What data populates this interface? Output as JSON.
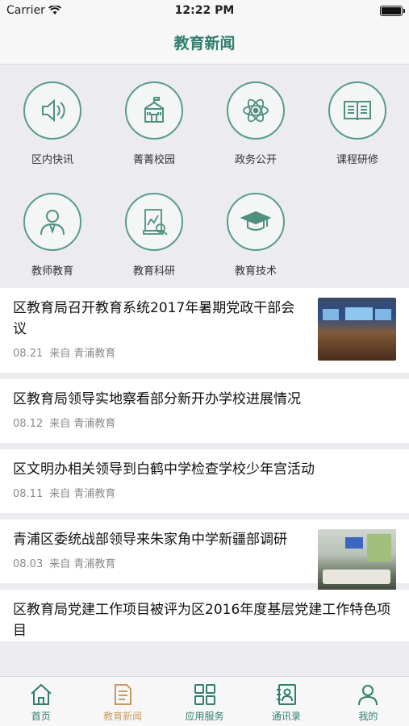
{
  "status_bar": {
    "carrier": "Carrier",
    "time": "12:22 PM"
  },
  "nav": {
    "title": "教育新闻"
  },
  "grid": {
    "items": [
      {
        "label": "区内快讯",
        "icon": "speaker-icon"
      },
      {
        "label": "菁菁校园",
        "icon": "school-icon"
      },
      {
        "label": "政务公开",
        "icon": "atom-icon"
      },
      {
        "label": "课程研修",
        "icon": "book-icon"
      },
      {
        "label": "教师教育",
        "icon": "teacher-icon"
      },
      {
        "label": "教育科研",
        "icon": "research-icon"
      },
      {
        "label": "教育技术",
        "icon": "graduation-cap-icon"
      }
    ]
  },
  "news": [
    {
      "headline": "区教育局召开教育系统2017年暑期党政干部会议",
      "date": "08.21",
      "source": "来自 青浦教育",
      "thumbnail": "meeting-hall-photo"
    },
    {
      "headline": "区教育局领导实地察看部分新开办学校进展情况",
      "date": "08.12",
      "source": "来自 青浦教育"
    },
    {
      "headline": "区文明办相关领导到白鹤中学检查学校少年宫活动",
      "date": "08.11",
      "source": "来自 青浦教育"
    },
    {
      "headline": "青浦区委统战部领导来朱家角中学新疆部调研",
      "date": "08.03",
      "source": "来自 青浦教育",
      "thumbnail": "meeting-room-photo"
    },
    {
      "headline": "区教育局党建工作项目被评为区2016年度基层党建工作特色项目",
      "date": "",
      "source": ""
    }
  ],
  "tabbar": {
    "active": "教育新闻",
    "items": [
      {
        "label": "首页",
        "icon": "home-icon"
      },
      {
        "label": "教育新闻",
        "icon": "news-icon"
      },
      {
        "label": "应用服务",
        "icon": "apps-grid-icon"
      },
      {
        "label": "通讯录",
        "icon": "contacts-icon"
      },
      {
        "label": "我的",
        "icon": "profile-icon"
      }
    ]
  },
  "colors": {
    "accent": "#2f7f6e",
    "active_tab": "#c99a5e",
    "icon_stroke": "#5a9a8c"
  }
}
